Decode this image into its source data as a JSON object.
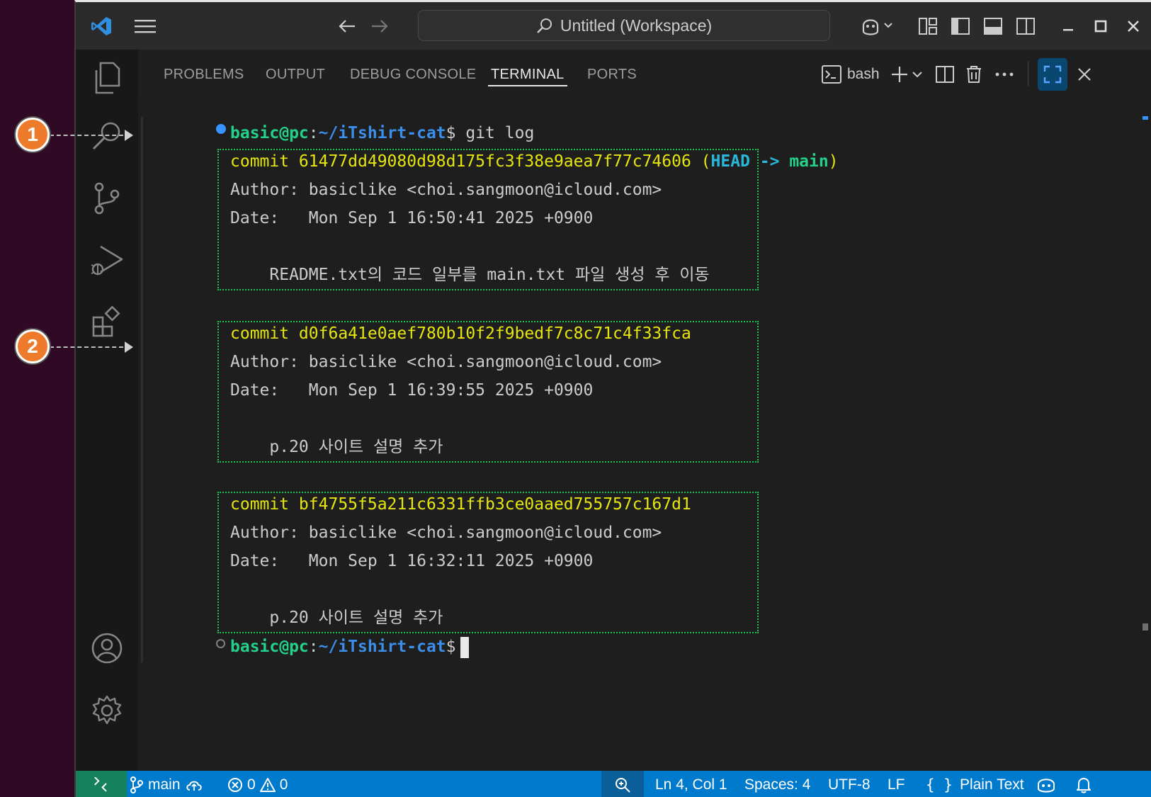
{
  "titlebar": {
    "title": "Untitled (Workspace)"
  },
  "panel": {
    "tabs": [
      "PROBLEMS",
      "OUTPUT",
      "DEBUG CONSOLE",
      "TERMINAL",
      "PORTS"
    ],
    "active_tab": "TERMINAL",
    "shell_name": "bash"
  },
  "terminal": {
    "prompt_user": "basic@pc",
    "prompt_sep": ":",
    "prompt_path": "~/iTshirt-cat",
    "prompt_dollar": "$",
    "command": " git log",
    "commits": [
      {
        "commit_line": "commit 61477dd49080d98d175fc3f38e9aea7f77c74606",
        "ref_open": " (",
        "ref_head": "HEAD -> ",
        "ref_branch": "main",
        "ref_close": ")",
        "author": "Author: basiclike <choi.sangmoon@icloud.com>",
        "date": "Date:   Mon Sep 1 16:50:41 2025 +0900",
        "message": "    README.txt의 코드 일부를 main.txt 파일 생성 후 이동"
      },
      {
        "commit_line": "commit d0f6a41e0aef780b10f2f9bedf7c8c71c4f33fca",
        "author": "Author: basiclike <choi.sangmoon@icloud.com>",
        "date": "Date:   Mon Sep 1 16:39:55 2025 +0900",
        "message": "    p.20 사이트 설명 추가"
      },
      {
        "commit_line": "commit bf4755f5a211c6331ffb3ce0aaed755757c167d1",
        "author": "Author: basiclike <choi.sangmoon@icloud.com>",
        "date": "Date:   Mon Sep 1 16:32:11 2025 +0900",
        "message": "    p.20 사이트 설명 추가"
      }
    ]
  },
  "statusbar": {
    "branch": "main",
    "errors": "0",
    "warnings": "0",
    "position": "Ln 4, Col 1",
    "spaces": "Spaces: 4",
    "encoding": "UTF-8",
    "eol": "LF",
    "language": "Plain Text"
  },
  "callouts": [
    "1",
    "2"
  ],
  "colors": {
    "statusbar": "#007acc",
    "callout": "#ee7b2c",
    "commit_box": "#1ec254"
  }
}
